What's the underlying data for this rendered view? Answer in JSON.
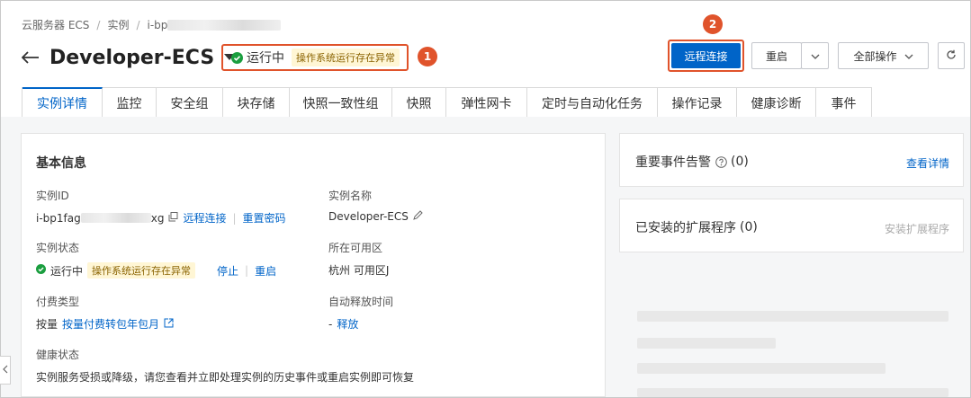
{
  "breadcrumb": {
    "items": [
      "云服务器 ECS",
      "实例",
      "i-bp"
    ],
    "separator": "/"
  },
  "header": {
    "title": "Developer-ECS",
    "status": "运行中",
    "warning": "操作系统运行存在异常"
  },
  "markers": [
    "1",
    "2"
  ],
  "actions": {
    "remote_connect": "远程连接",
    "restart": "重启",
    "all_ops": "全部操作"
  },
  "tabs": [
    "实例详情",
    "监控",
    "安全组",
    "块存储",
    "快照一致性组",
    "快照",
    "弹性网卡",
    "定时与自动化任务",
    "操作记录",
    "健康诊断",
    "事件"
  ],
  "basic": {
    "title": "基本信息",
    "instance_id": {
      "label": "实例ID",
      "value_prefix": "i-bp1fag",
      "value_suffix": "xg",
      "link_remote": "远程连接",
      "link_reset": "重置密码"
    },
    "instance_name": {
      "label": "实例名称",
      "value": "Developer-ECS"
    },
    "instance_status": {
      "label": "实例状态",
      "value": "运行中",
      "warning": "操作系统运行存在异常",
      "link_stop": "停止",
      "link_restart": "重启"
    },
    "zone": {
      "label": "所在可用区",
      "value": "杭州 可用区J"
    },
    "billing": {
      "label": "付费类型",
      "value": "按量",
      "link": "按量付费转包年包月"
    },
    "auto_release": {
      "label": "自动释放时间",
      "value": "-",
      "link": "释放"
    },
    "health": {
      "label": "健康状态",
      "value": "实例服务受损或降级，请您查看并立即处理实例的历史事件或重启实例即可恢复"
    }
  },
  "side": {
    "alerts": {
      "title": "重要事件告警",
      "count": "(0)",
      "link": "查看详情"
    },
    "extensions": {
      "title": "已安装的扩展程序",
      "count": "(0)",
      "link": "安装扩展程序"
    }
  },
  "colors": {
    "primary": "#0064c8",
    "highlight": "#e0532b",
    "success": "#1a9e3f",
    "warning_bg": "#fff6d5"
  },
  "icons": [
    "back-arrow-icon",
    "caret-down-icon",
    "check-circle-icon",
    "chevron-down-icon",
    "refresh-icon",
    "copy-icon",
    "edit-icon",
    "external-link-icon",
    "help-circle-icon",
    "chevron-left-icon"
  ]
}
